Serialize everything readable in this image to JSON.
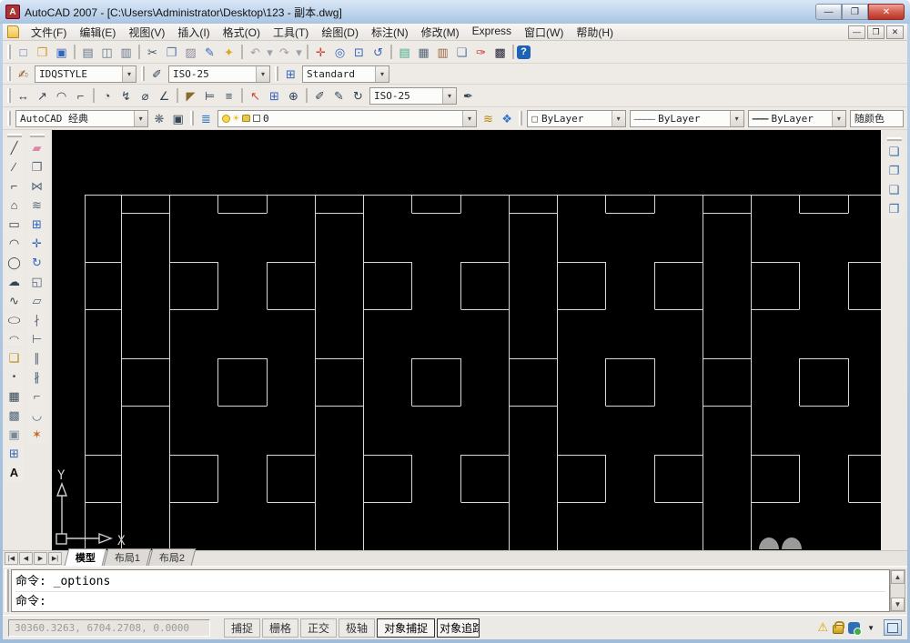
{
  "window": {
    "title": "AutoCAD 2007 - [C:\\Users\\Administrator\\Desktop\\123 - 副本.dwg]",
    "minimize_glyph": "—",
    "maximize_glyph": "❐",
    "close_glyph": "✕"
  },
  "menu": {
    "items": [
      "文件(F)",
      "编辑(E)",
      "视图(V)",
      "插入(I)",
      "格式(O)",
      "工具(T)",
      "绘图(D)",
      "标注(N)",
      "修改(M)",
      "Express",
      "窗口(W)",
      "帮助(H)"
    ],
    "mdi_buttons": [
      {
        "name": "mdi-minimize-button",
        "glyph": "—"
      },
      {
        "name": "mdi-restore-button",
        "glyph": "❐"
      },
      {
        "name": "mdi-close-button",
        "glyph": "✕"
      }
    ]
  },
  "toolbar_standard": {
    "icons": [
      {
        "name": "new-file-icon",
        "glyph": "□",
        "style": "color:#5577aa"
      },
      {
        "name": "open-icon",
        "glyph": "❒",
        "style": "color:#d49a2a"
      },
      {
        "name": "save-icon",
        "glyph": "▣",
        "style": "color:#3366bb"
      },
      {
        "name": "separator",
        "glyph": "",
        "style": "width:1px;height:16px;background:#bbb7b1;margin:0 3px",
        "inter": "false"
      },
      {
        "name": "plot-icon",
        "glyph": "▤",
        "style": "color:#667788"
      },
      {
        "name": "plot-preview-icon",
        "glyph": "◫",
        "style": "color:#667788"
      },
      {
        "name": "publish-icon",
        "glyph": "▥",
        "style": "color:#667788"
      },
      {
        "name": "separator",
        "glyph": "",
        "style": "width:1px;height:16px;background:#bbb7b1;margin:0 3px",
        "inter": "false"
      },
      {
        "name": "cut-icon",
        "glyph": "✂",
        "style": "color:#445566"
      },
      {
        "name": "copy-icon",
        "glyph": "❐",
        "style": "color:#5577aa"
      },
      {
        "name": "paste-icon",
        "glyph": "▨",
        "style": "color:#888899"
      },
      {
        "name": "match-properties-icon",
        "glyph": "✎",
        "style": "color:#3366bb"
      },
      {
        "name": "block-editor-icon",
        "glyph": "✦",
        "style": "color:#e0a520"
      },
      {
        "name": "separator",
        "glyph": "",
        "style": "width:1px;height:16px;background:#bbb7b1;margin:0 3px",
        "inter": "false"
      },
      {
        "name": "undo-icon",
        "glyph": "↶",
        "style": "color:#9aa0a8"
      },
      {
        "name": "undo-dropdown-icon",
        "glyph": "▾",
        "style": "color:#9aa0a8;width:11px"
      },
      {
        "name": "redo-icon",
        "glyph": "↷",
        "style": "color:#9aa0a8"
      },
      {
        "name": "redo-dropdown-icon",
        "glyph": "▾",
        "style": "color:#9aa0a8;width:11px"
      },
      {
        "name": "separator",
        "glyph": "",
        "style": "width:1px;height:16px;background:#bbb7b1;margin:0 3px",
        "inter": "false"
      },
      {
        "name": "pan-realtime-icon",
        "glyph": "✛",
        "style": "color:#cc4433"
      },
      {
        "name": "zoom-realtime-icon",
        "glyph": "◎",
        "style": "color:#3366bb"
      },
      {
        "name": "zoom-window-icon",
        "glyph": "⊡",
        "style": "color:#3366bb"
      },
      {
        "name": "zoom-previous-icon",
        "glyph": "↺",
        "style": "color:#3366bb"
      },
      {
        "name": "separator",
        "glyph": "",
        "style": "width:1px;height:16px;background:#bbb7b1;margin:0 3px",
        "inter": "false"
      },
      {
        "name": "properties-palette-icon",
        "glyph": "▤",
        "style": "color:#44aa88"
      },
      {
        "name": "designcenter-icon",
        "glyph": "▦",
        "style": "color:#556677"
      },
      {
        "name": "tool-palettes-icon",
        "glyph": "▥",
        "style": "color:#996644"
      },
      {
        "name": "sheet-set-manager-icon",
        "glyph": "❏",
        "style": "color:#5577aa"
      },
      {
        "name": "markup-set-manager-icon",
        "glyph": "✑",
        "style": "color:#cc3333"
      },
      {
        "name": "quickcalc-icon",
        "glyph": "▩",
        "style": "color:#222233"
      },
      {
        "name": "separator",
        "glyph": "",
        "style": "width:1px;height:16px;background:#bbb7b1;margin:0 3px",
        "inter": "false"
      },
      {
        "name": "help-icon",
        "glyph": "?",
        "style": "color:#fff;background:#1c62b5;border-radius:3px;font-weight:bold;width:15px;height:15px;font-size:11px"
      }
    ]
  },
  "toolbar_styles": {
    "text_style_icon": "✍",
    "text_style_value": "IDQSTYLE",
    "dim_style_icon": "✐",
    "dim_style_value": "ISO-25",
    "table_style_icon": "⊞",
    "table_style_value": "Standard"
  },
  "toolbar_dimension": {
    "icons": [
      {
        "name": "dim-linear-icon",
        "glyph": "↔",
        "style": "color:#334455"
      },
      {
        "name": "dim-aligned-icon",
        "glyph": "↗",
        "style": "color:#334455"
      },
      {
        "name": "dim-arc-length-icon",
        "glyph": "◠",
        "style": "color:#334455"
      },
      {
        "name": "dim-ordinate-icon",
        "glyph": "⌐",
        "style": "color:#334455"
      },
      {
        "name": "separator",
        "glyph": "",
        "style": "width:1px;height:16px;background:#bbb7b1;margin:0 3px",
        "inter": "false"
      },
      {
        "name": "dim-radius-icon",
        "glyph": "◔",
        "style": "color:#334455"
      },
      {
        "name": "dim-jogged-icon",
        "glyph": "↯",
        "style": "color:#334455"
      },
      {
        "name": "dim-diameter-icon",
        "glyph": "⌀",
        "style": "color:#334455"
      },
      {
        "name": "dim-angular-icon",
        "glyph": "∠",
        "style": "color:#334455"
      },
      {
        "name": "separator",
        "glyph": "",
        "style": "width:1px;height:16px;background:#bbb7b1;margin:0 3px",
        "inter": "false"
      },
      {
        "name": "quick-dimension-icon",
        "glyph": "◤",
        "style": "color:#8a6a2a"
      },
      {
        "name": "dim-baseline-icon",
        "glyph": "⊨",
        "style": "color:#334455"
      },
      {
        "name": "dim-continue-icon",
        "glyph": "≡",
        "style": "color:#334455"
      },
      {
        "name": "separator",
        "glyph": "",
        "style": "width:1px;height:16px;background:#bbb7b1;margin:0 3px",
        "inter": "false"
      },
      {
        "name": "quick-leader-icon",
        "glyph": "↖",
        "style": "color:#cc4433"
      },
      {
        "name": "tolerance-icon",
        "glyph": "⊞",
        "style": "color:#3366bb"
      },
      {
        "name": "center-mark-icon",
        "glyph": "⊕",
        "style": "color:#334455"
      },
      {
        "name": "separator",
        "glyph": "",
        "style": "width:1px;height:16px;background:#bbb7b1;margin:0 3px",
        "inter": "false"
      },
      {
        "name": "dimension-edit-icon",
        "glyph": "✐",
        "style": "color:#334455"
      },
      {
        "name": "dimension-text-edit-icon",
        "glyph": "✎",
        "style": "color:#334455"
      },
      {
        "name": "dimension-update-icon",
        "glyph": "↻",
        "style": "color:#334455"
      }
    ],
    "style_value": "ISO-25",
    "dim_style_button_icon": "✒"
  },
  "toolbar_workspace": {
    "value": "AutoCAD 经典",
    "gear_icon": "❋",
    "save_workspace_icon": "▣"
  },
  "toolbar_layers": {
    "layer_properties_icon": "≣",
    "combo_icons": [
      {
        "name": "layer-on-bulb-icon",
        "glyph": "",
        "style": "width:9px;height:9px;background:#ffd84a;border:1px solid #b89a20;border-radius:50%"
      },
      {
        "name": "layer-freeze-sun-icon",
        "glyph": "☀",
        "style": "color:#e8b800;font-size:12px"
      },
      {
        "name": "layer-lock-icon",
        "glyph": "",
        "style": "width:9px;height:8px;background:#e8c84a;border:1px solid #a88820;border-radius:2px 2px 1px 1px"
      },
      {
        "name": "layer-color-swatch",
        "glyph": "",
        "style": "width:8px;height:8px;background:#fff;border:1px solid #666"
      }
    ],
    "current_layer": "0",
    "layer_previous_icon": "≋",
    "layer-states-icon": "❖"
  },
  "toolbar_properties": {
    "color_swatch": "□",
    "color_value": "ByLayer",
    "linetype_sample": "————",
    "linetype_value": "ByLayer",
    "lineweight_sample": "———",
    "lineweight_value": "ByLayer",
    "plot_style_value": "随颜色"
  },
  "draw_toolbar": {
    "icons": [
      {
        "name": "line-icon",
        "glyph": "╱",
        "style": "color:#334455"
      },
      {
        "name": "construction-line-icon",
        "glyph": "∕",
        "style": "color:#334455"
      },
      {
        "name": "polyline-icon",
        "glyph": "⌐",
        "style": "color:#334455"
      },
      {
        "name": "polygon-icon",
        "glyph": "⌂",
        "style": "color:#334455"
      },
      {
        "name": "rectangle-icon",
        "glyph": "▭",
        "style": "color:#334455"
      },
      {
        "name": "arc-icon",
        "glyph": "◠",
        "style": "color:#334455"
      },
      {
        "name": "circle-icon",
        "glyph": "◯",
        "style": "color:#334455"
      },
      {
        "name": "revcloud-icon",
        "glyph": "☁",
        "style": "color:#334455"
      },
      {
        "name": "spline-icon",
        "glyph": "∿",
        "style": "color:#334455"
      },
      {
        "name": "ellipse-icon",
        "glyph": "◯",
        "style": "color:#334455;transform:scaleY(.55)"
      },
      {
        "name": "ellipse-arc-icon",
        "glyph": "◠",
        "style": "color:#334455;transform:scaleY(.7)"
      },
      {
        "name": "insert-block-icon",
        "glyph": "❑",
        "style": "color:#b8860b"
      },
      {
        "name": "point-icon",
        "glyph": "•",
        "style": "color:#334455;font-size:10px"
      },
      {
        "name": "hatch-icon",
        "glyph": "▦",
        "style": "color:#334455"
      },
      {
        "name": "gradient-icon",
        "glyph": "▩",
        "style": "color:#556677"
      },
      {
        "name": "region-icon",
        "glyph": "▣",
        "style": "color:#778899"
      },
      {
        "name": "table-icon",
        "glyph": "⊞",
        "style": "color:#3366bb"
      },
      {
        "name": "mtext-icon",
        "glyph": "A",
        "style": "color:#111;font-weight:bold"
      }
    ]
  },
  "modify_toolbar": {
    "icons": [
      {
        "name": "erase-icon",
        "glyph": "▰",
        "style": "color:#dd88aa"
      },
      {
        "name": "copy-object-icon",
        "glyph": "❐",
        "style": "color:#556677"
      },
      {
        "name": "mirror-icon",
        "glyph": "⋈",
        "style": "color:#556677"
      },
      {
        "name": "offset-icon",
        "glyph": "≋",
        "style": "color:#556677"
      },
      {
        "name": "array-icon",
        "glyph": "⊞",
        "style": "color:#3366bb"
      },
      {
        "name": "move-icon",
        "glyph": "✛",
        "style": "color:#3366bb"
      },
      {
        "name": "rotate-icon",
        "glyph": "↻",
        "style": "color:#3366bb"
      },
      {
        "name": "scale-icon",
        "glyph": "◱",
        "style": "color:#556677"
      },
      {
        "name": "stretch-icon",
        "glyph": "▱",
        "style": "color:#556677"
      },
      {
        "name": "trim-icon",
        "glyph": "∤",
        "style": "color:#556677"
      },
      {
        "name": "extend-icon",
        "glyph": "⊢",
        "style": "color:#556677"
      },
      {
        "name": "break-at-point-icon",
        "glyph": "∥",
        "style": "color:#556677"
      },
      {
        "name": "break-icon",
        "glyph": "∦",
        "style": "color:#556677"
      },
      {
        "name": "chamfer-icon",
        "glyph": "⌐",
        "style": "color:#556677"
      },
      {
        "name": "fillet-icon",
        "glyph": "◡",
        "style": "color:#556677"
      },
      {
        "name": "explode-icon",
        "glyph": "✶",
        "style": "color:#cc6622"
      }
    ]
  },
  "draworder_toolbar": {
    "icons": [
      {
        "name": "bring-to-front-icon",
        "glyph": "❏",
        "style": "color:#3a6ea5"
      },
      {
        "name": "send-to-back-icon",
        "glyph": "❐",
        "style": "color:#3a6ea5"
      },
      {
        "name": "bring-above-objects-icon",
        "glyph": "❑",
        "style": "color:#3a6ea5"
      },
      {
        "name": "send-under-objects-icon",
        "glyph": "❒",
        "style": "color:#3a6ea5"
      }
    ]
  },
  "canvas": {
    "background": "#000000",
    "line_color": "#d8d8d8",
    "ucs_x_label": "X",
    "ucs_y_label": "Y"
  },
  "tabs": {
    "nav": [
      {
        "name": "tab-first-button",
        "glyph": "|◀"
      },
      {
        "name": "tab-prev-button",
        "glyph": "◀"
      },
      {
        "name": "tab-next-button",
        "glyph": "▶"
      },
      {
        "name": "tab-last-button",
        "glyph": "▶|"
      }
    ],
    "items": [
      {
        "label": "模型",
        "cls": "tab active",
        "name": "tab-model"
      },
      {
        "label": "布局1",
        "cls": "tab",
        "name": "tab-layout1"
      },
      {
        "label": "布局2",
        "cls": "tab",
        "name": "tab-layout2"
      }
    ]
  },
  "command": {
    "line1": "命令: _options",
    "line2": "命令:",
    "scroll_up_glyph": "▲",
    "scroll_down_glyph": "▼"
  },
  "statusbar": {
    "coordinates": "30360.3263, 6704.2708, 0.0000",
    "toggles": [
      {
        "label": "捕捉",
        "cls": "sb-toggle",
        "name": "toggle-snap"
      },
      {
        "label": "栅格",
        "cls": "sb-toggle",
        "name": "toggle-grid"
      },
      {
        "label": "正交",
        "cls": "sb-toggle",
        "name": "toggle-ortho"
      },
      {
        "label": "极轴",
        "cls": "sb-toggle",
        "name": "toggle-polar"
      },
      {
        "label": "对象捕捉",
        "cls": "sb-toggle on",
        "name": "toggle-osnap"
      },
      {
        "label": "对象追踪",
        "cls": "sb-toggle on clip",
        "name": "toggle-otrack"
      }
    ],
    "tray_arrow_glyph": "▼"
  }
}
